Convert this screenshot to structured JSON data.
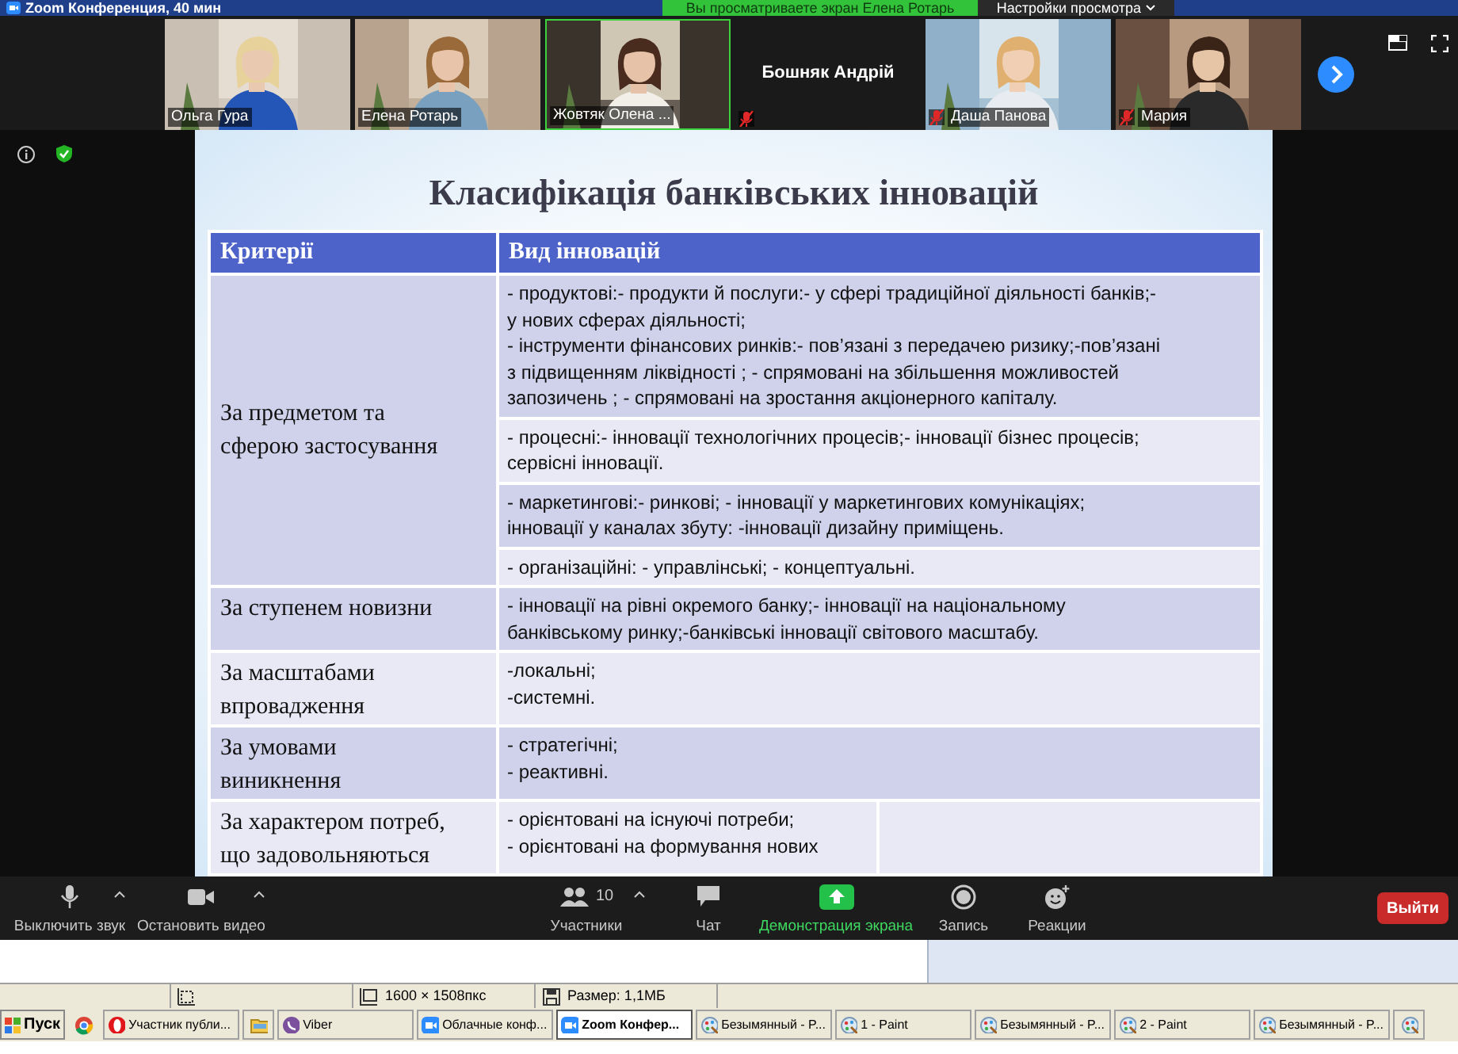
{
  "window": {
    "title": "Zoom Конференция, 40 мин"
  },
  "share_banner": {
    "text": "Вы просматриваете экран Елена Ротарь",
    "view_options": "Настройки просмотра"
  },
  "participants": [
    {
      "name": "Ольга Гура",
      "kind": "video",
      "muted": false,
      "speaking": false
    },
    {
      "name": "Елена Ротарь",
      "kind": "video",
      "muted": false,
      "speaking": false
    },
    {
      "name": "Жовтяк Олена ...",
      "kind": "video",
      "muted": false,
      "speaking": true
    },
    {
      "name": "Бошняк Андрій",
      "kind": "name",
      "muted": true,
      "speaking": false
    },
    {
      "name": "Даша Панова",
      "kind": "video",
      "muted": true,
      "speaking": false
    },
    {
      "name": "Мария",
      "kind": "video",
      "muted": true,
      "speaking": false
    }
  ],
  "slide": {
    "title": "Класифікація банківських інновацій",
    "columns": [
      "Критерії",
      "Вид  інновацій"
    ],
    "rows": [
      {
        "criterion": "За предметом та\nсферою застосування",
        "split": false,
        "items": [
          "- продуктові:- продукти й послуги:- у сфері традиційної діяльності банків;-\nу нових сферах діяльності;\n- інструменти фінансових ринків:- пов’язані з передачею ризику;-пов’язані\nз підвищенням ліквідності ; - спрямовані на збільшення можливостей\nзапозичень ; - спрямовані на зростання акціонерного капіталу.",
          "- процесні:- інновації технологічних процесів;- інновації бізнес процесів;\nсервісні інновації.",
          "- маркетингові:- ринкові; - інновації у маркетингових комунікаціях;\nінновації  у каналах збуту: -інновації дизайну приміщень.",
          "- організаційні:  - управлінські;  - концептуальні."
        ]
      },
      {
        "criterion": "За ступенем новизни",
        "split": false,
        "items": [
          "- інновації на рівні окремого банку;- інновації на національному\nбанківському ринку;-банківські інновації світового масштабу."
        ]
      },
      {
        "criterion": "За масштабами\nвпровадження",
        "split": false,
        "items": [
          "-локальні;\n-системні."
        ]
      },
      {
        "criterion": "За  умовами\nвиникнення",
        "split": false,
        "items": [
          "- стратегічні;\n- реактивні."
        ]
      },
      {
        "criterion": "За характером потреб,\nщо задовольняються",
        "split": true,
        "items": [
          "- орієнтовані на існуючі потреби;\n- орієнтовані на формування нових"
        ]
      }
    ]
  },
  "toolbar": {
    "items": [
      {
        "kind": "mic",
        "label": "Выключить звук",
        "caret": true
      },
      {
        "kind": "video",
        "label": "Остановить видео",
        "caret": true
      },
      {
        "kind": "participants",
        "label": "Участники",
        "count": "10",
        "caret": true
      },
      {
        "kind": "chat",
        "label": "Чат",
        "caret": false
      },
      {
        "kind": "share",
        "label": "Демонстрация экрана",
        "caret": false
      },
      {
        "kind": "record",
        "label": "Запись",
        "caret": false
      },
      {
        "kind": "reactions",
        "label": "Реакции",
        "caret": false
      }
    ],
    "leave": "Выйти"
  },
  "status_bar": {
    "cells": [
      {
        "kind": "selection"
      },
      {
        "kind": "size",
        "text": "1600 × 1508пкс"
      },
      {
        "kind": "disk",
        "text": "Размер: 1,1МБ"
      }
    ]
  },
  "taskbar": {
    "start": "Пуск",
    "quick_launch": [
      {
        "kind": "chrome"
      }
    ],
    "tasks": [
      {
        "kind": "opera",
        "label": "Участник публи...",
        "selected": false
      },
      {
        "kind": "folder",
        "selected": false
      },
      {
        "kind": "viber",
        "label": "Viber",
        "selected": false
      },
      {
        "kind": "zoom",
        "label": "Облачные конф...",
        "selected": false
      },
      {
        "kind": "zoom",
        "label": "Zoom Конфер...",
        "selected": true
      },
      {
        "kind": "paint",
        "label": "Безымянный - P...",
        "selected": false
      },
      {
        "kind": "paint",
        "label": "1 - Paint",
        "selected": false
      },
      {
        "kind": "paint",
        "label": "Безымянный - P...",
        "selected": false
      },
      {
        "kind": "paint",
        "label": "2 - Paint",
        "selected": false
      },
      {
        "kind": "paint",
        "label": "Безымянный - P...",
        "selected": false
      },
      {
        "kind": "paint",
        "selected": false
      }
    ]
  }
}
